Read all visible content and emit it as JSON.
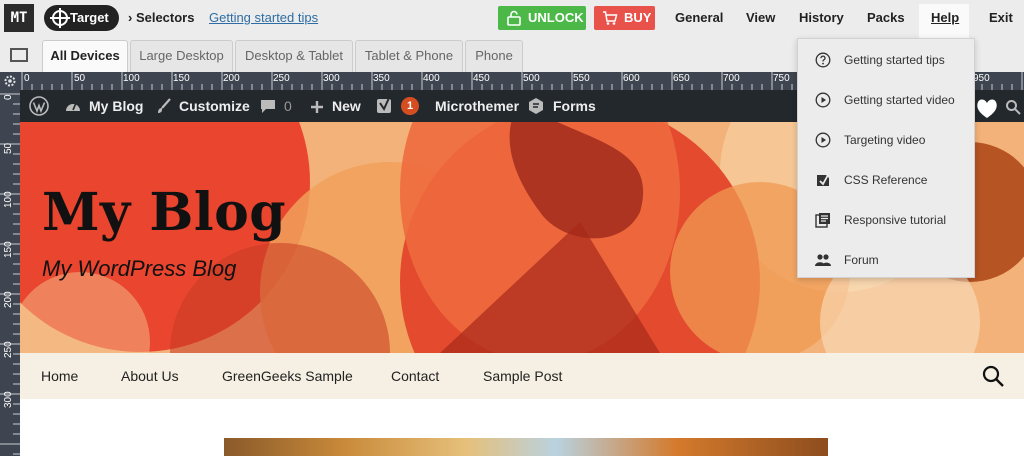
{
  "app": {
    "logo": "MT",
    "target_label": "Target",
    "selectors_label": "› Selectors",
    "getting_started_link": "Getting started tips",
    "unlock_label": "UNLOCK",
    "buy_label": "BUY",
    "menus": [
      "General",
      "View",
      "History",
      "Packs",
      "Help",
      "Exit"
    ],
    "colors": {
      "unlock": "#4cb848",
      "buy": "#e9524a",
      "ruler": "#3f4550"
    }
  },
  "tabs": [
    "All Devices",
    "Large Desktop",
    "Desktop & Tablet",
    "Tablet & Phone",
    "Phone"
  ],
  "active_tab": "All Devices",
  "ruler": {
    "h_labels": [
      "0",
      "50",
      "100",
      "150",
      "200",
      "250",
      "300",
      "350",
      "400",
      "450",
      "500",
      "550",
      "600",
      "650",
      "700",
      "750",
      "950"
    ],
    "v_labels": [
      "0",
      "50",
      "100",
      "150",
      "200",
      "250",
      "300"
    ]
  },
  "help_menu": {
    "items": [
      {
        "label": "Getting started tips",
        "icon": "question-icon"
      },
      {
        "label": "Getting started video",
        "icon": "play-icon"
      },
      {
        "label": "Targeting video",
        "icon": "play-icon"
      },
      {
        "label": "CSS Reference",
        "icon": "css-reference-icon"
      },
      {
        "label": "Responsive tutorial",
        "icon": "tutorial-icon"
      },
      {
        "label": "Forum",
        "icon": "people-icon"
      }
    ]
  },
  "adminbar": {
    "site_name": "My Blog",
    "customize": "Customize",
    "comments_count": "0",
    "new_label": "New",
    "yoast_count": "1",
    "microthemer": "Microthemer",
    "forms": "Forms"
  },
  "site": {
    "title": "My Blog",
    "description": "My WordPress Blog",
    "nav": [
      "Home",
      "About Us",
      "GreenGeeks Sample",
      "Contact",
      "Sample Post"
    ]
  }
}
